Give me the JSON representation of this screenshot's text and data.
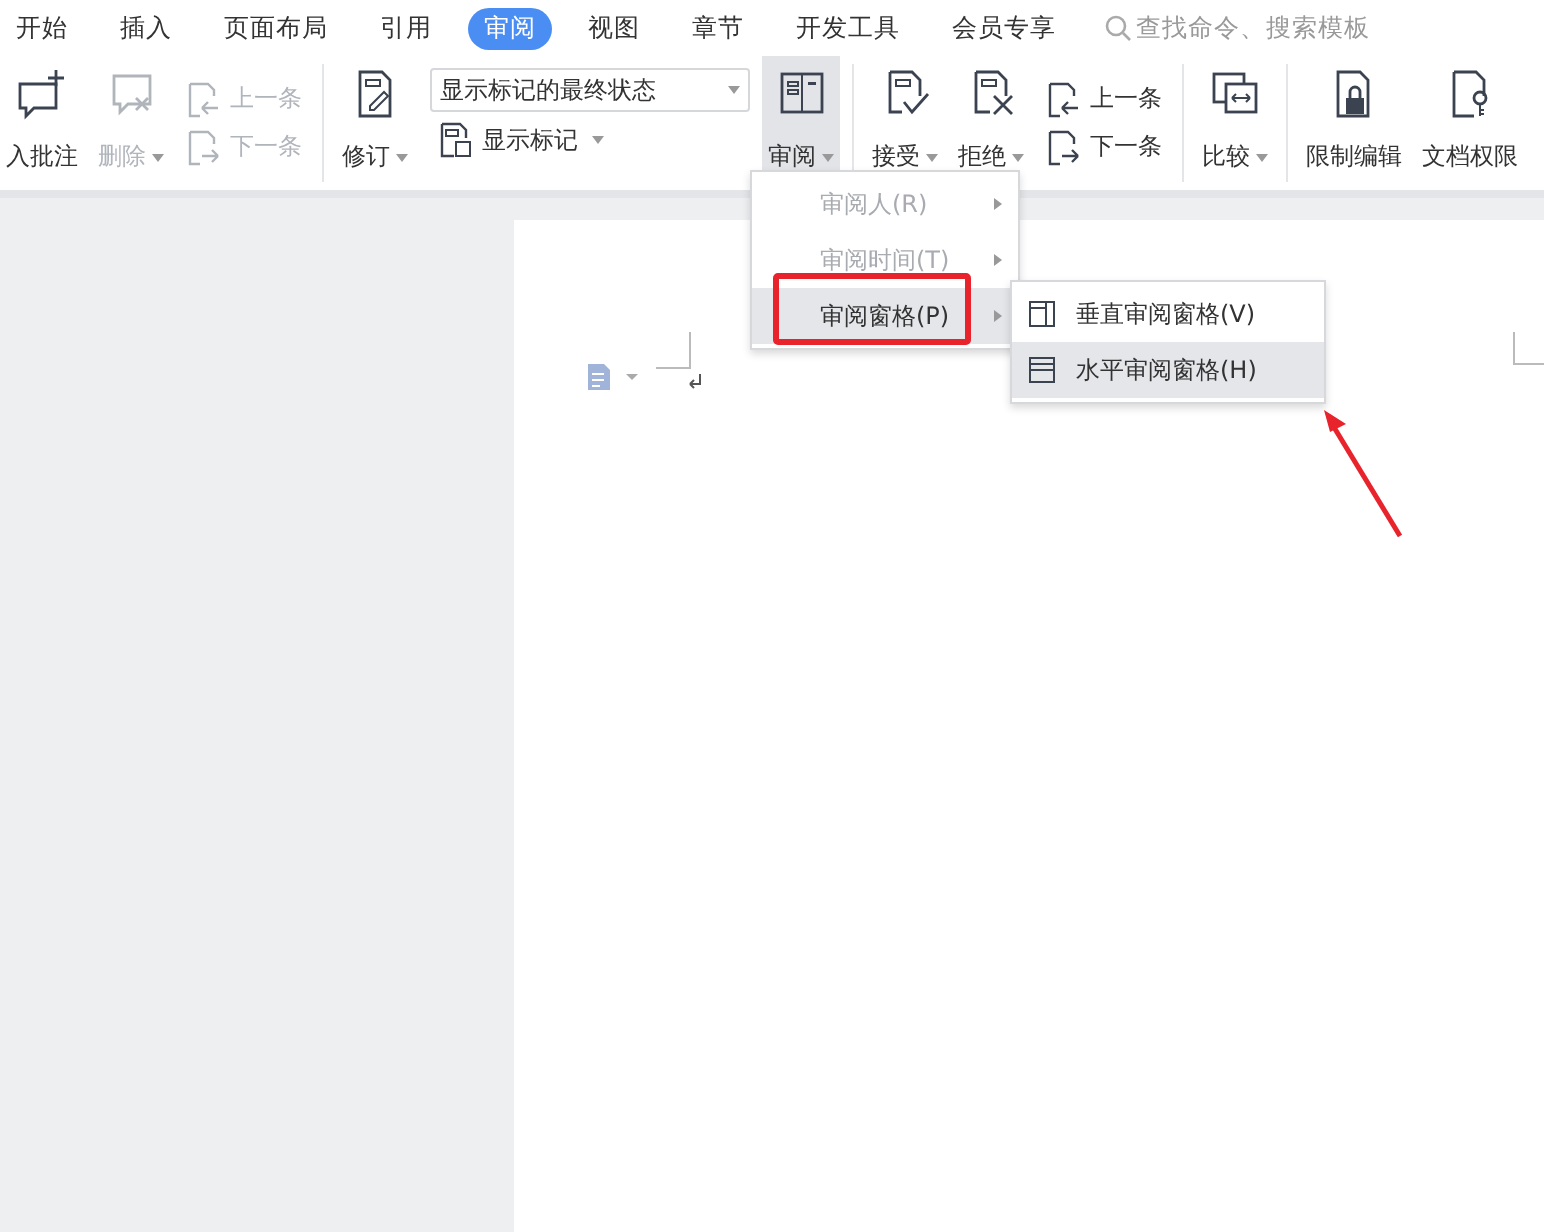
{
  "tabs": [
    {
      "label": "开始",
      "selected": false
    },
    {
      "label": "插入",
      "selected": false
    },
    {
      "label": "页面布局",
      "selected": false
    },
    {
      "label": "引用",
      "selected": false
    },
    {
      "label": "审阅",
      "selected": true
    },
    {
      "label": "视图",
      "selected": false
    },
    {
      "label": "章节",
      "selected": false
    },
    {
      "label": "开发工具",
      "selected": false
    },
    {
      "label": "会员专享",
      "selected": false
    }
  ],
  "search": {
    "placeholder": "查找命令、搜索模板"
  },
  "ribbon": [
    {
      "kind": "big",
      "label": "入批注",
      "caret": false,
      "disabled": false,
      "pressed": false
    },
    {
      "kind": "big",
      "label": "删除",
      "caret": true,
      "disabled": true,
      "pressed": false
    },
    {
      "kind": "pair",
      "items": [
        {
          "label": "上一条",
          "disabled": true
        },
        {
          "label": "下一条",
          "disabled": true
        }
      ]
    },
    {
      "kind": "separator"
    },
    {
      "kind": "big",
      "label": "修订",
      "caret": true,
      "disabled": false,
      "pressed": false
    },
    {
      "kind": "markup",
      "value": "显示标记的最终状态",
      "label": "显示标记"
    },
    {
      "kind": "big",
      "label": "审阅",
      "caret": true,
      "disabled": false,
      "pressed": true
    },
    {
      "kind": "separator"
    },
    {
      "kind": "big",
      "label": "接受",
      "caret": true,
      "disabled": false,
      "pressed": false
    },
    {
      "kind": "big",
      "label": "拒绝",
      "caret": true,
      "disabled": false,
      "pressed": false
    },
    {
      "kind": "pair",
      "items": [
        {
          "label": "上一条",
          "disabled": false
        },
        {
          "label": "下一条",
          "disabled": false
        }
      ]
    },
    {
      "kind": "separator"
    },
    {
      "kind": "big",
      "label": "比较",
      "caret": true,
      "disabled": false,
      "pressed": false
    },
    {
      "kind": "separator"
    },
    {
      "kind": "big",
      "label": "限制编辑",
      "caret": false,
      "disabled": false,
      "pressed": false
    },
    {
      "kind": "big",
      "label": "文档权限",
      "caret": false,
      "disabled": false,
      "pressed": false
    }
  ],
  "menu": {
    "items": [
      {
        "label": "审阅人(R)",
        "disabled": true,
        "selected": false
      },
      {
        "label": "审阅时间(T)",
        "disabled": true,
        "selected": false
      },
      {
        "label": "审阅窗格(P)",
        "disabled": false,
        "selected": true
      }
    ],
    "submenu": [
      {
        "label": "垂直审阅窗格(V)",
        "kind": "vertical",
        "selected": false
      },
      {
        "label": "水平审阅窗格(H)",
        "kind": "horizontal",
        "selected": true
      }
    ]
  }
}
